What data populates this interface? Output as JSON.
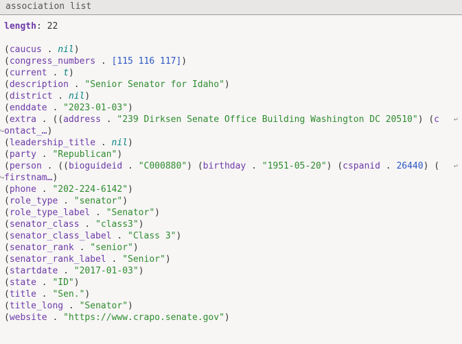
{
  "header": {
    "title": "association list"
  },
  "meta": {
    "length_label": "length",
    "length_value": ": 22"
  },
  "rows": [
    {
      "key": "caucus",
      "sep": " . ",
      "val_type": "nil",
      "val": "nil",
      "close": ")"
    },
    {
      "key": "congress_numbers",
      "sep": " . ",
      "val_type": "numlist",
      "val": "[115 116 117]",
      "close": ")"
    },
    {
      "key": "current",
      "sep": " . ",
      "val_type": "t",
      "val": "t",
      "close": ")"
    },
    {
      "key": "description",
      "sep": " . ",
      "val_type": "str",
      "val": "\"Senior Senator for Idaho\"",
      "close": ")"
    },
    {
      "key": "district",
      "sep": " . ",
      "val_type": "nil",
      "val": "nil",
      "close": ")"
    },
    {
      "key": "enddate",
      "sep": " . ",
      "val_type": "str",
      "val": "\"2023-01-03\"",
      "close": ")"
    },
    {
      "key": "extra",
      "sep": " . ",
      "val_type": "nested",
      "val": "((address . \"239 Dirksen Senate Office Building Washington DC 20510\") (c",
      "close": "",
      "wrap": true
    },
    {
      "key": "",
      "cont": true,
      "cont_text": "ontact_…",
      "close": ")"
    },
    {
      "key": "leadership_title",
      "sep": " . ",
      "val_type": "nil",
      "val": "nil",
      "close": ")"
    },
    {
      "key": "party",
      "sep": " . ",
      "val_type": "str",
      "val": "\"Republican\"",
      "close": ")"
    },
    {
      "key": "person",
      "sep": " . ",
      "val_type": "nested",
      "val": "((bioguideid . \"C000880\") (birthday . \"1951-05-20\") (cspanid . 26440) (",
      "close": "",
      "wrap": true
    },
    {
      "key": "",
      "cont": true,
      "cont_text": "firstnam…",
      "close": ")"
    },
    {
      "key": "phone",
      "sep": " . ",
      "val_type": "str",
      "val": "\"202-224-6142\"",
      "close": ")"
    },
    {
      "key": "role_type",
      "sep": " . ",
      "val_type": "str",
      "val": "\"senator\"",
      "close": ")"
    },
    {
      "key": "role_type_label",
      "sep": " . ",
      "val_type": "str",
      "val": "\"Senator\"",
      "close": ")"
    },
    {
      "key": "senator_class",
      "sep": " . ",
      "val_type": "str",
      "val": "\"class3\"",
      "close": ")"
    },
    {
      "key": "senator_class_label",
      "sep": " . ",
      "val_type": "str",
      "val": "\"Class 3\"",
      "close": ")"
    },
    {
      "key": "senator_rank",
      "sep": " . ",
      "val_type": "str",
      "val": "\"senior\"",
      "close": ")"
    },
    {
      "key": "senator_rank_label",
      "sep": " . ",
      "val_type": "str",
      "val": "\"Senior\"",
      "close": ")"
    },
    {
      "key": "startdate",
      "sep": " . ",
      "val_type": "str",
      "val": "\"2017-01-03\"",
      "close": ")"
    },
    {
      "key": "state",
      "sep": " . ",
      "val_type": "str",
      "val": "\"ID\"",
      "close": ")"
    },
    {
      "key": "title",
      "sep": " . ",
      "val_type": "str",
      "val": "\"Sen.\"",
      "close": ")"
    },
    {
      "key": "title_long",
      "sep": " . ",
      "val_type": "str",
      "val": "\"Senator\"",
      "close": ")"
    },
    {
      "key": "website",
      "sep": " . ",
      "val_type": "str",
      "val": "\"https://www.crapo.senate.gov\"",
      "close": ")"
    }
  ],
  "glyphs": {
    "wrap_left": "↪",
    "wrap_right": "↩"
  }
}
